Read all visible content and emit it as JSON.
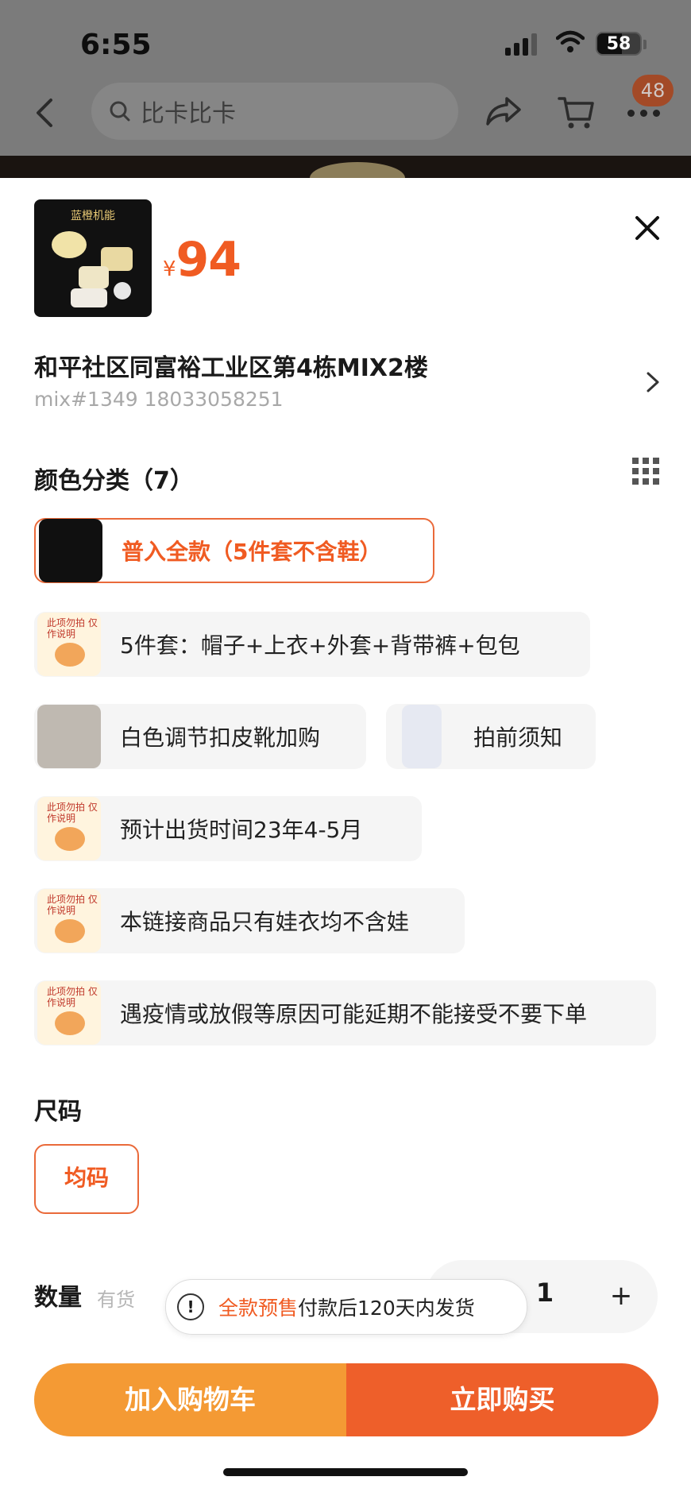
{
  "status_bar": {
    "time": "6:55",
    "battery": "58"
  },
  "header": {
    "search_placeholder": "比卡比卡",
    "cart_badge": "48"
  },
  "product": {
    "thumb_caption": "蓝橙机能",
    "currency": "¥",
    "price": "94"
  },
  "address": {
    "line1": "和平社区同富裕工业区第4栋MIX2楼",
    "line2": "mix#1349 18033058251"
  },
  "color_section": {
    "title": "颜色分类（7）",
    "options": [
      {
        "label": "普入全款（5件套不含鞋）",
        "selected": true,
        "icon": "product-photo"
      },
      {
        "label": "5件套：帽子+上衣+外套+背带裤+包包",
        "icon": "tiger-notice"
      },
      {
        "label": "白色调节扣皮靴加购",
        "icon": "boot-photo"
      },
      {
        "label": "拍前须知",
        "icon": "document-photo"
      },
      {
        "label": "预计出货时间23年4-5月",
        "icon": "tiger-notice"
      },
      {
        "label": "本链接商品只有娃衣均不含娃",
        "icon": "tiger-notice"
      },
      {
        "label": "遇疫情或放假等原因可能延期不能接受不要下单",
        "icon": "tiger-notice"
      }
    ],
    "tiger_caption": "此项勿拍 仅作说明"
  },
  "size_section": {
    "title": "尺码",
    "option": "均码"
  },
  "quantity": {
    "label": "数量",
    "stock": "有货",
    "value": "1",
    "plus": "+"
  },
  "notice": {
    "highlight": "全款预售",
    "text": "付款后120天内发货"
  },
  "actions": {
    "add_to_cart": "加入购物车",
    "buy_now": "立即购买"
  },
  "colors": {
    "accent": "#F05B22",
    "cart_button": "#F49A34",
    "buy_button": "#EE5F2A"
  }
}
